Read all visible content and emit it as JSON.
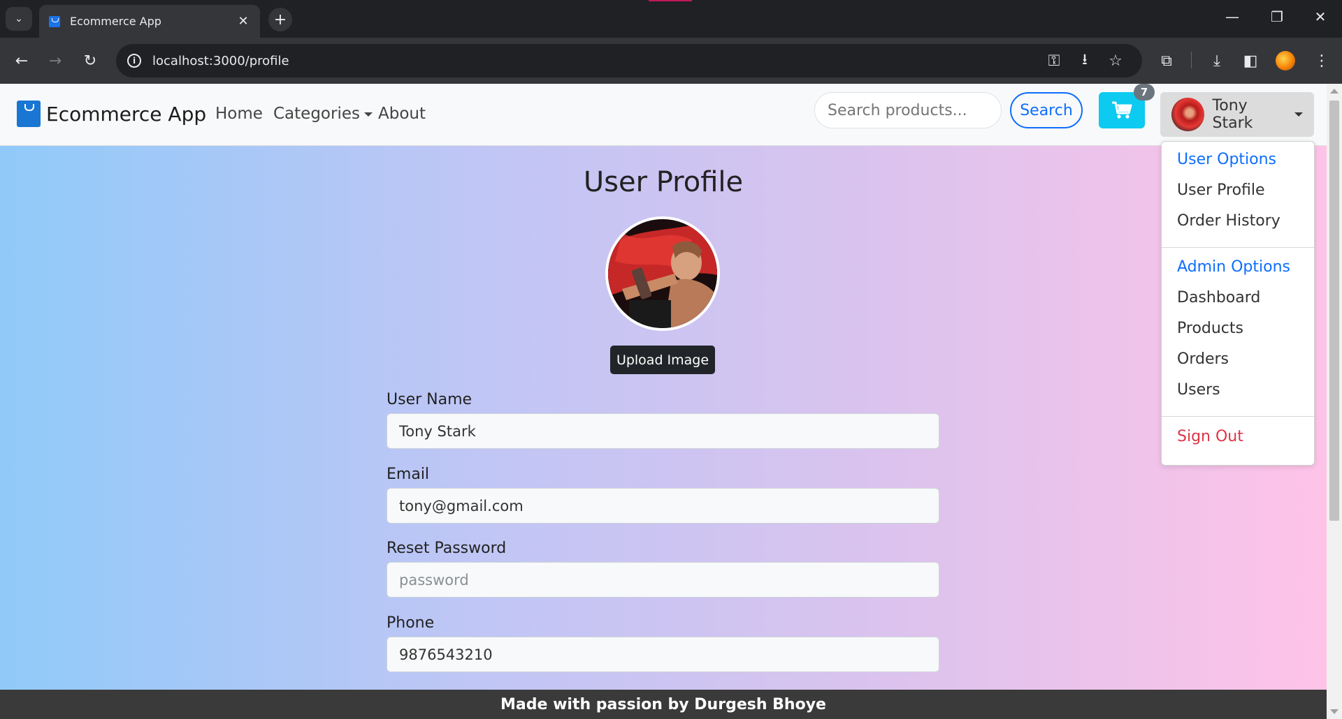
{
  "browser": {
    "tab_title": "Ecommerce App",
    "url": "localhost:3000/profile"
  },
  "app": {
    "brand": "Ecommerce App",
    "nav": {
      "home": "Home",
      "categories": "Categories",
      "about": "About"
    },
    "search": {
      "placeholder": "Search products...",
      "button": "Search"
    },
    "cart_count": "7",
    "user_name": "Tony Stark"
  },
  "dropdown": {
    "user_header": "User Options",
    "user_profile": "User Profile",
    "order_history": "Order History",
    "admin_header": "Admin Options",
    "dashboard": "Dashboard",
    "products": "Products",
    "orders": "Orders",
    "users": "Users",
    "sign_out": "Sign Out"
  },
  "profile": {
    "title": "User Profile",
    "upload_button": "Upload Image",
    "fields": {
      "username_label": "User Name",
      "username_value": "Tony Stark",
      "email_label": "Email",
      "email_value": "tony@gmail.com",
      "password_label": "Reset Password",
      "password_placeholder": "password",
      "phone_label": "Phone",
      "phone_value": "9876543210"
    }
  },
  "footer": {
    "text": "Made with passion by   Durgesh Bhoye"
  },
  "colors": {
    "primary": "#0d6efd",
    "info": "#0dcaf0",
    "danger": "#dc3545",
    "dark": "#212529"
  },
  "icons": [
    "tab-search-icon",
    "favicon-icon",
    "close-icon",
    "new-tab-icon",
    "back-icon",
    "forward-icon",
    "reload-icon",
    "info-icon",
    "key-icon",
    "install-icon",
    "star-icon",
    "extensions-icon",
    "download-icon",
    "sidepanel-icon",
    "menu-icon",
    "cart-icon"
  ]
}
